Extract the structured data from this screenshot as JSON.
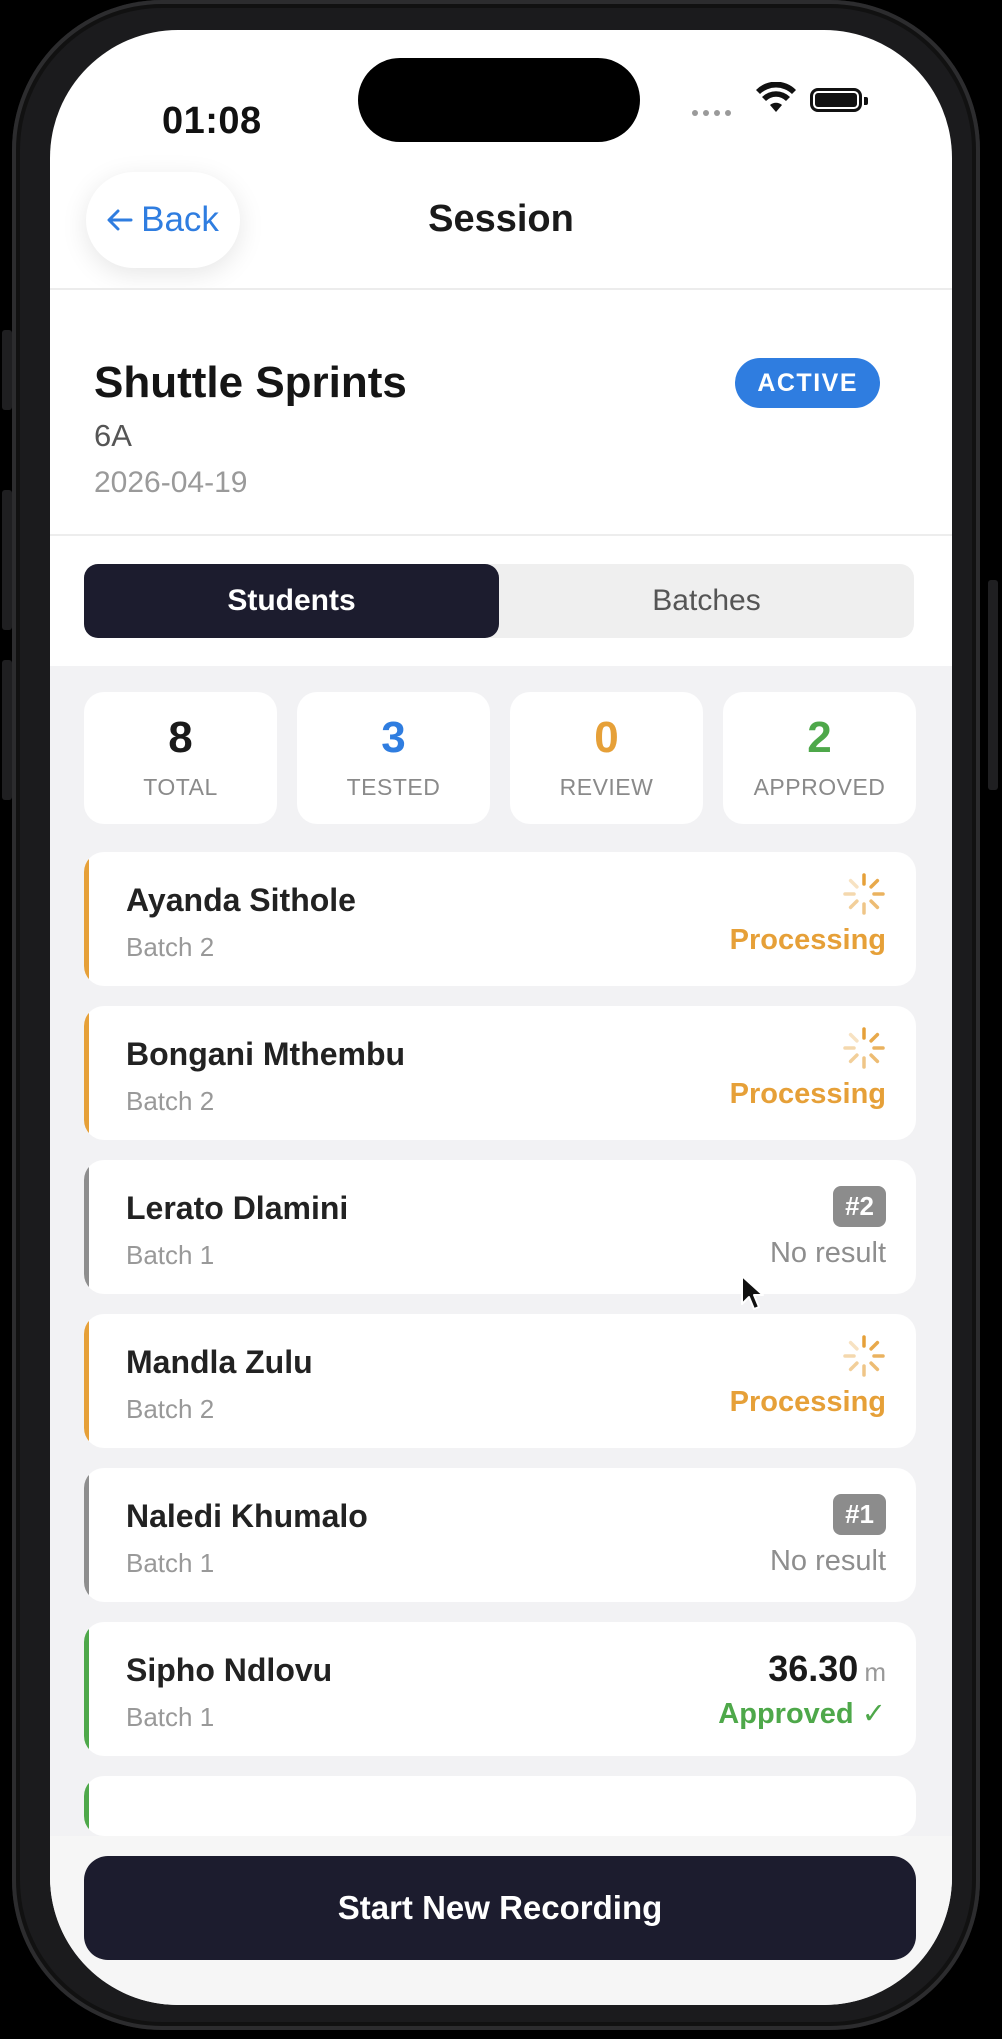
{
  "status_bar": {
    "time": "01:08"
  },
  "nav": {
    "back_label": "Back",
    "title": "Session"
  },
  "session": {
    "name": "Shuttle Sprints",
    "class": "6A",
    "date": "2026-04-19",
    "status_badge": "ACTIVE"
  },
  "tabs": [
    {
      "label": "Students",
      "active": true
    },
    {
      "label": "Batches",
      "active": false
    }
  ],
  "stats": [
    {
      "value": "8",
      "label": "TOTAL",
      "color": "#1a1a1a"
    },
    {
      "value": "3",
      "label": "TESTED",
      "color": "#2f7de0"
    },
    {
      "value": "0",
      "label": "REVIEW",
      "color": "#e6a038"
    },
    {
      "value": "2",
      "label": "APPROVED",
      "color": "#4ea84a"
    }
  ],
  "students": [
    {
      "name": "Ayanda Sithole",
      "batch": "Batch 2",
      "status": "Processing"
    },
    {
      "name": "Bongani Mthembu",
      "batch": "Batch 2",
      "status": "Processing"
    },
    {
      "name": "Lerato Dlamini",
      "batch": "Batch 1",
      "attempt": "#2",
      "status": "No result"
    },
    {
      "name": "Mandla Zulu",
      "batch": "Batch 2",
      "status": "Processing"
    },
    {
      "name": "Naledi Khumalo",
      "batch": "Batch 1",
      "attempt": "#1",
      "status": "No result"
    },
    {
      "name": "Sipho Ndlovu",
      "batch": "Batch 1",
      "result": "36.30",
      "unit": "m",
      "status": "Approved ✓"
    }
  ],
  "cta_label": "Start New Recording",
  "colors": {
    "processing": "#e6a038",
    "approved": "#4ea84a",
    "no_result": "#8e8e8e",
    "accent": "#2f7de0",
    "dark": "#1c1c2e"
  }
}
